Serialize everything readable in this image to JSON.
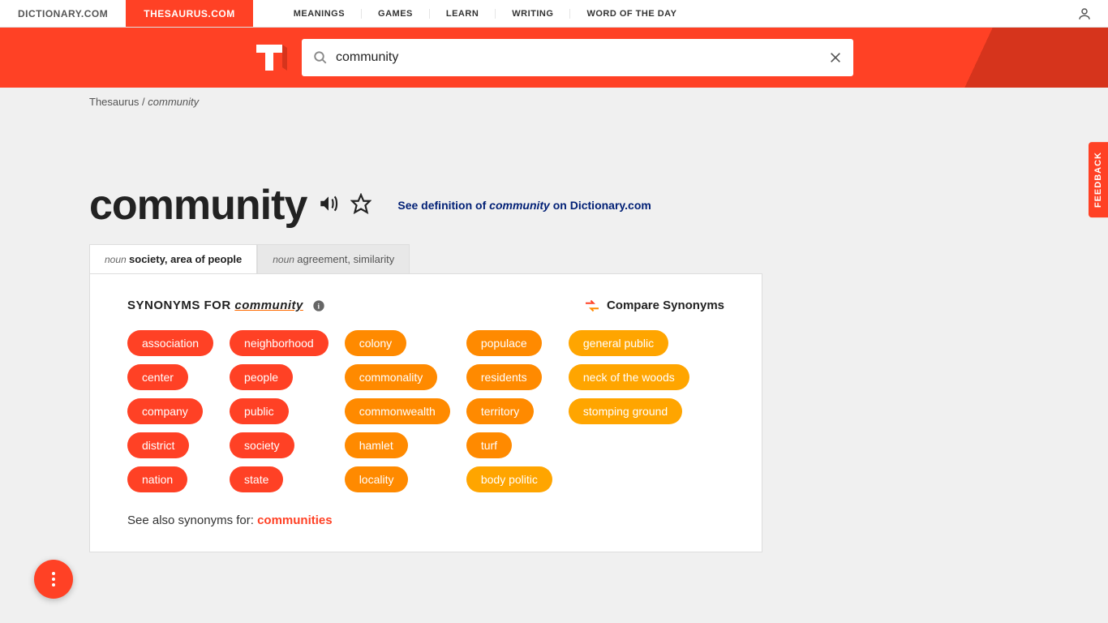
{
  "topnav": {
    "brands": [
      {
        "label": "DICTIONARY.COM",
        "active": false
      },
      {
        "label": "THESAURUS.COM",
        "active": true
      }
    ],
    "links": [
      "MEANINGS",
      "GAMES",
      "LEARN",
      "WRITING",
      "WORD OF THE DAY"
    ]
  },
  "search": {
    "value": "community"
  },
  "breadcrumb": {
    "root": "Thesaurus",
    "separator": "/",
    "current": "community"
  },
  "headword": "community",
  "definition_link": {
    "prefix": "See definition of ",
    "word": "community",
    "suffix": " on Dictionary.com"
  },
  "tabs": [
    {
      "pos": "noun",
      "def": "society, area of people",
      "active": true
    },
    {
      "pos": "noun",
      "def": "agreement, similarity",
      "active": false
    }
  ],
  "syn_header": {
    "prefix": "SYNONYMS FOR ",
    "word": "community"
  },
  "compare_label": "Compare Synonyms",
  "synonym_columns": [
    [
      {
        "label": "association",
        "color": "red"
      },
      {
        "label": "center",
        "color": "red"
      },
      {
        "label": "company",
        "color": "red"
      },
      {
        "label": "district",
        "color": "red"
      },
      {
        "label": "nation",
        "color": "red"
      }
    ],
    [
      {
        "label": "neighborhood",
        "color": "red"
      },
      {
        "label": "people",
        "color": "red"
      },
      {
        "label": "public",
        "color": "red"
      },
      {
        "label": "society",
        "color": "red"
      },
      {
        "label": "state",
        "color": "red"
      }
    ],
    [
      {
        "label": "colony",
        "color": "orange-dark"
      },
      {
        "label": "commonality",
        "color": "orange-dark"
      },
      {
        "label": "commonwealth",
        "color": "orange-dark"
      },
      {
        "label": "hamlet",
        "color": "orange-dark"
      },
      {
        "label": "locality",
        "color": "orange-dark"
      }
    ],
    [
      {
        "label": "populace",
        "color": "orange-dark"
      },
      {
        "label": "residents",
        "color": "orange-dark"
      },
      {
        "label": "territory",
        "color": "orange-dark"
      },
      {
        "label": "turf",
        "color": "orange-dark"
      },
      {
        "label": "body politic",
        "color": "orange"
      }
    ],
    [
      {
        "label": "general public",
        "color": "orange"
      },
      {
        "label": "neck of the woods",
        "color": "orange"
      },
      {
        "label": "stomping ground",
        "color": "orange"
      }
    ]
  ],
  "see_also": {
    "prefix": "See also synonyms for: ",
    "link": "communities"
  },
  "feedback_label": "FEEDBACK"
}
